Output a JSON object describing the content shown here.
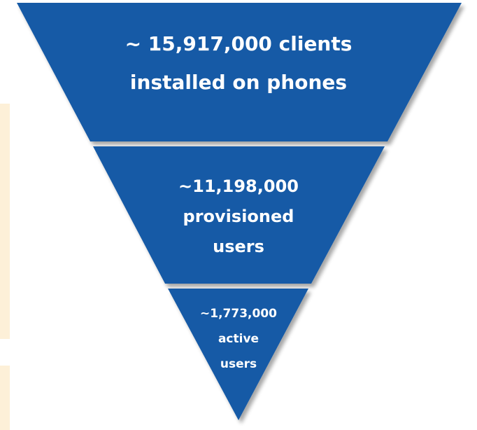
{
  "colors": {
    "tier_fill": "#145aa6",
    "text": "#ffffff",
    "shadow": "#c9c9c9",
    "side_band": "#fdf0d8"
  },
  "funnel": {
    "tiers": [
      {
        "lines": [
          "~ 15,917,000 clients",
          "installed on phones"
        ]
      },
      {
        "lines": [
          "~11,198,000",
          "provisioned",
          "users"
        ]
      },
      {
        "lines": [
          "~1,773,000",
          "active",
          "users"
        ]
      }
    ]
  }
}
